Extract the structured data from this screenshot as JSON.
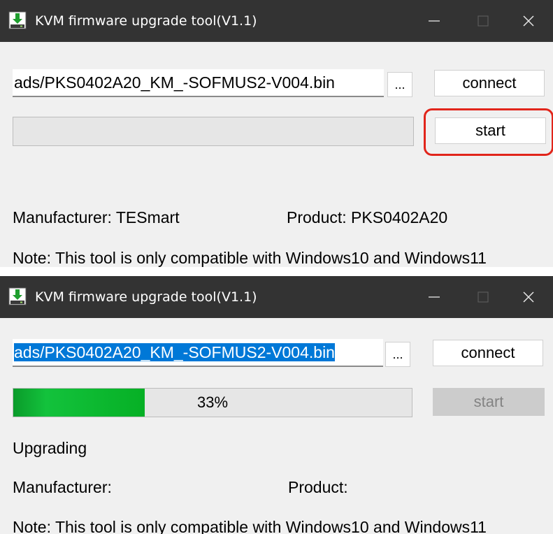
{
  "colors": {
    "titlebar": "#333333",
    "window": "#f0f0f0",
    "progress_fill": "#06b025",
    "selection": "#0078d7",
    "highlight": "#e1251b"
  },
  "before": {
    "window_title": "KVM firmware upgrade tool(V1.1)",
    "file_path": "ads/PKS0402A20_KM_-SOFMUS2-V004.bin",
    "browse_label": "...",
    "connect_label": "connect",
    "start_label": "start",
    "progress": 0,
    "manufacturer": "Manufacturer: TESmart",
    "product": "Product: PKS0402A20",
    "note": "Note: This tool is only compatible with Windows10 and Windows11"
  },
  "after": {
    "window_title": "KVM firmware upgrade tool(V1.1)",
    "file_path": "ads/PKS0402A20_KM_-SOFMUS2-V004.bin",
    "browse_label": "...",
    "connect_label": "connect",
    "start_label": "start",
    "progress": 0.33,
    "progress_text": "33%",
    "status": "Upgrading",
    "manufacturer": "Manufacturer:",
    "product": "Product:",
    "note": "Note: This tool is only compatible with Windows10 and Windows11"
  }
}
